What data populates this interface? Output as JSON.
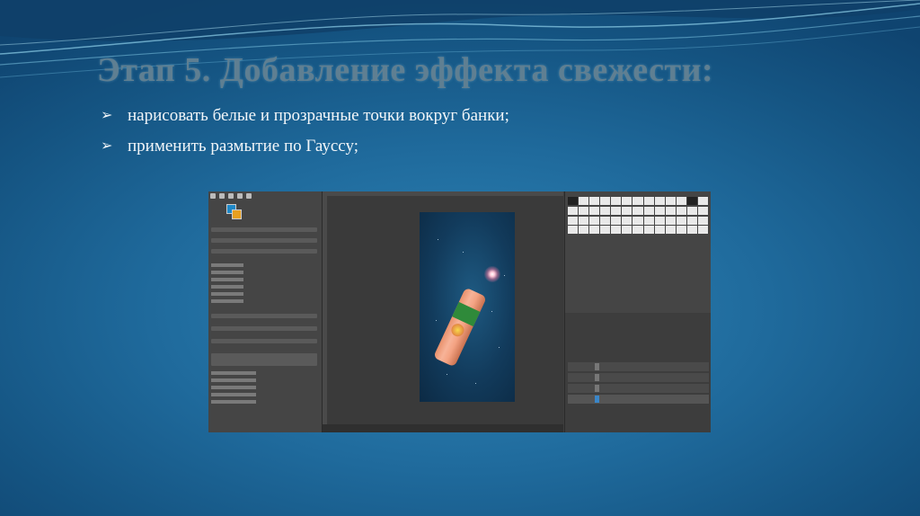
{
  "slide": {
    "title": "Этап 5. Добавление эффекта свежести:",
    "bullets": [
      {
        "marker": "➢",
        "text": "нарисовать белые и прозрачные точки вокруг банки;"
      },
      {
        "marker": "➢",
        "text": "применить размытие по Гауссу;"
      }
    ]
  },
  "colors": {
    "background": "#1f6a9c",
    "title": "#5f7f92",
    "bullet_text": "#f2f6f9"
  },
  "screenshot": {
    "app": "GIMP",
    "icons": [
      "gimp-toolbox-icons",
      "brushes-panel",
      "layers-panel"
    ]
  }
}
